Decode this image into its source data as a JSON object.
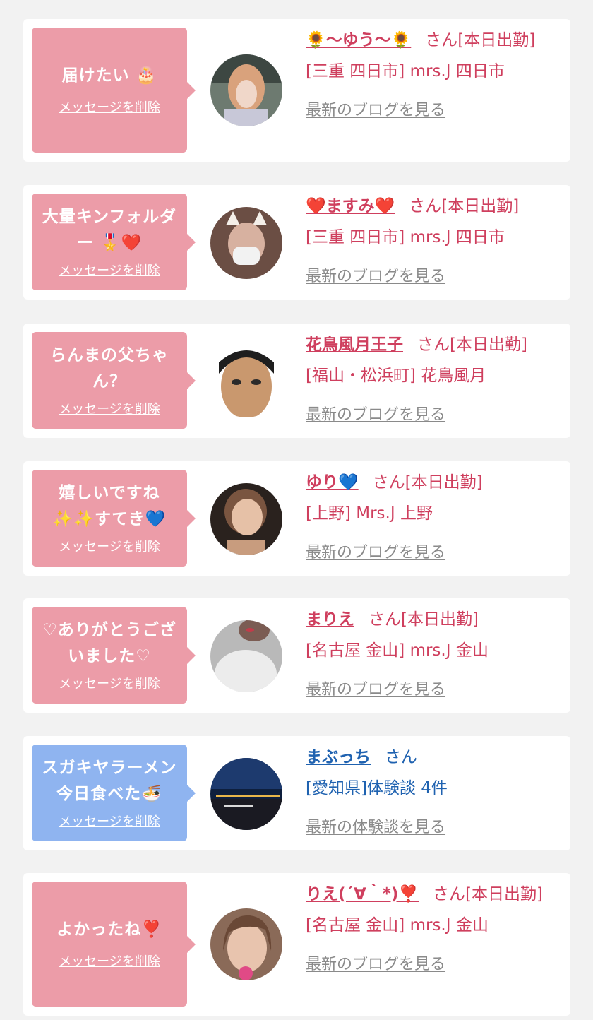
{
  "delete_label": "メッセージを削除",
  "colors": {
    "pink_bubble": "#ec9ca8",
    "blue_bubble": "#8fb4f0",
    "name_pink": "#cf3f5e",
    "name_blue": "#1f62b0",
    "link_gray": "#8a8a8a"
  },
  "cards": [
    {
      "message": "届けたい 🎂",
      "name": "🌻〜ゆう〜🌻",
      "san": "さん[本日出勤]",
      "shop": "[三重 四日市] mrs.J 四日市",
      "blog_link": "最新のブログを見る",
      "bubble_color": "pink",
      "avatar_icon": "woman-photo"
    },
    {
      "message": "大量キンフォルダー 🎖️❤️",
      "name": "❤️ますみ❤️",
      "san": "さん[本日出勤]",
      "shop": "[三重 四日市] mrs.J 四日市",
      "blog_link": "最新のブログを見る",
      "bubble_color": "pink",
      "avatar_icon": "woman-cat-ears-photo"
    },
    {
      "message": "らんまの父ちゃん？",
      "name": "花鳥風月王子",
      "san": "さん[本日出勤]",
      "shop": "[福山・松浜町] 花鳥風月",
      "blog_link": "最新のブログを見る",
      "bubble_color": "pink",
      "avatar_icon": "man-face-photo"
    },
    {
      "message": "嬉しいですね ✨✨すてき💙",
      "name": "ゆり💙",
      "san": "さん[本日出勤]",
      "shop": "[上野] Mrs.J 上野",
      "blog_link": "最新のブログを見る",
      "bubble_color": "pink",
      "avatar_icon": "woman-smiling-photo"
    },
    {
      "message": "♡ありがとうございました♡",
      "name": "まりえ",
      "san": "さん[本日出勤]",
      "shop": "[名古屋 金山] mrs.J 金山",
      "blog_link": "最新のブログを見る",
      "bubble_color": "pink",
      "avatar_icon": "woman-white-photo"
    },
    {
      "message": "スガキヤラーメン今日食べた🍜",
      "name": "まぶっち",
      "san": "さん",
      "shop": "[愛知県]体験談 4件",
      "blog_link": "最新の体験談を見る",
      "bubble_color": "blue",
      "avatar_icon": "night-city-photo"
    },
    {
      "message": "よかったね❣️",
      "name": "りえ(´∀｀*)❣️",
      "san": "さん[本日出勤]",
      "shop": "[名古屋 金山] mrs.J 金山",
      "blog_link": "最新のブログを見る",
      "bubble_color": "pink",
      "avatar_icon": "woman-blurred-photo"
    }
  ]
}
